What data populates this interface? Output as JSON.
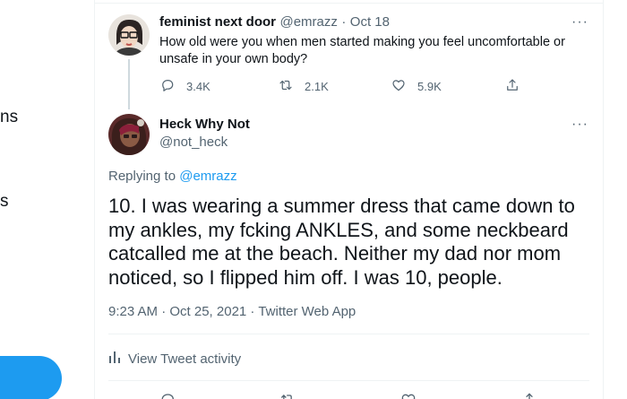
{
  "sidebar": {
    "fragments": [
      "ns",
      "s"
    ]
  },
  "quoted_tweet": {
    "display_name": "feminist next door",
    "handle": "@emrazz",
    "separator": "·",
    "date": "Oct 18",
    "text": "How old were you when men started making you feel uncomfortable or unsafe in your own body?",
    "reply_count": "3.4K",
    "retweet_count": "2.1K",
    "like_count": "5.9K",
    "more": "···"
  },
  "tweet": {
    "display_name": "Heck Why Not",
    "handle": "@not_heck",
    "more": "···",
    "replying_prefix": "Replying to",
    "replying_to": "@emrazz",
    "text": "10. I was wearing a summer dress that came down to my ankles, my fcking ANKLES, and some neckbeard catcalled me at the beach. Neither my dad nor mom noticed, so I flipped him off. I was 10, people.",
    "timestamp": "9:23 AM · Oct 25, 2021 · Twitter Web App",
    "activity_label": "View Tweet activity"
  },
  "colors": {
    "accent": "#1d9bf0",
    "muted": "#536471",
    "divider": "#eff3f4"
  }
}
